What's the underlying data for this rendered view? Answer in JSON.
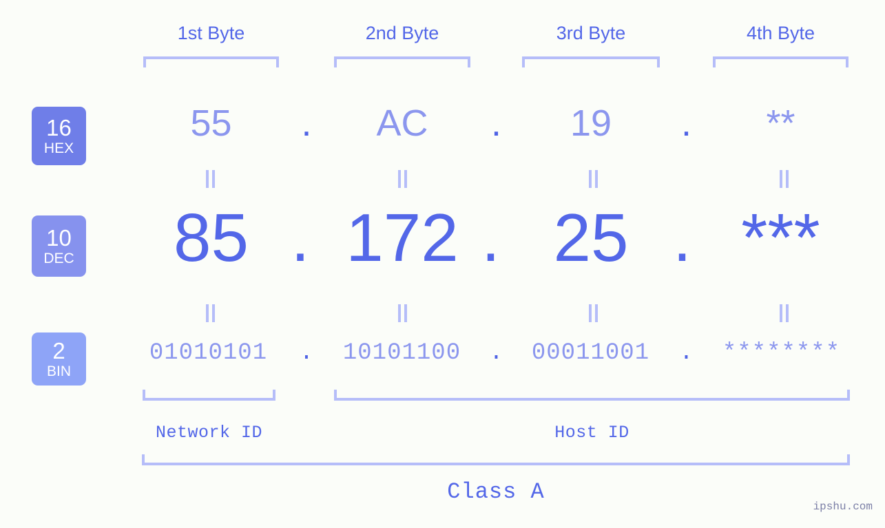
{
  "watermark": "ipshu.com",
  "byte_headers": [
    {
      "label": "1st Byte"
    },
    {
      "label": "2nd Byte"
    },
    {
      "label": "3rd Byte"
    },
    {
      "label": "4th Byte"
    }
  ],
  "bases": [
    {
      "number": "16",
      "name": "HEX",
      "color": "#6f7ee8"
    },
    {
      "number": "10",
      "name": "DEC",
      "color": "#8692ee"
    },
    {
      "number": "2",
      "name": "BIN",
      "color": "#8ea4f7"
    }
  ],
  "rows": {
    "hex": {
      "values": [
        "55",
        "AC",
        "19",
        "**"
      ],
      "separator": "."
    },
    "dec": {
      "values": [
        "85",
        "172",
        "25",
        "***"
      ],
      "separator": "."
    },
    "bin": {
      "values": [
        "01010101",
        "10101100",
        "00011001",
        "********"
      ],
      "separator": "."
    }
  },
  "equals_symbol": "=",
  "id_sections": [
    {
      "label": "Network ID"
    },
    {
      "label": "Host ID"
    }
  ],
  "class_section": {
    "label": "Class A"
  },
  "colors": {
    "background": "#fbfdf9",
    "accent": "#5367e8",
    "accent_light": "#8b96ee",
    "bracket": "#b5bdf9"
  }
}
